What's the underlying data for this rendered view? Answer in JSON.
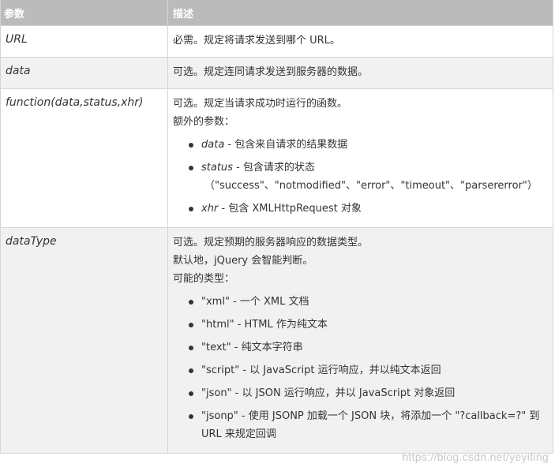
{
  "header": {
    "col_param": "参数",
    "col_desc": "描述"
  },
  "rows": {
    "url": {
      "param": "URL",
      "desc": "必需。规定将请求发送到哪个 URL。"
    },
    "data": {
      "param": "data",
      "desc": "可选。规定连同请求发送到服务器的数据。"
    },
    "function": {
      "param": "function(data,status,xhr)",
      "desc_line1": "可选。规定当请求成功时运行的函数。",
      "desc_line2": "额外的参数：",
      "items": [
        {
          "name": "data",
          "text": " - 包含来自请求的结果数据"
        },
        {
          "name": "status",
          "text": " - 包含请求的状态",
          "sub": "（\"success\"、\"notmodified\"、\"error\"、\"timeout\"、\"parsererror\"）"
        },
        {
          "name": "xhr",
          "text": " - 包含 XMLHttpRequest 对象"
        }
      ]
    },
    "datatype": {
      "param": "dataType",
      "desc_line1": "可选。规定预期的服务器响应的数据类型。",
      "desc_line2": "默认地，jQuery 会智能判断。",
      "desc_line3": "可能的类型：",
      "items": [
        "\"xml\" - 一个 XML 文档",
        "\"html\" - HTML 作为纯文本",
        "\"text\" - 纯文本字符串",
        "\"script\" - 以 JavaScript 运行响应，并以纯文本返回",
        "\"json\" - 以 JSON 运行响应，并以 JavaScript 对象返回",
        "\"jsonp\" - 使用 JSONP 加载一个 JSON 块，将添加一个 \"?callback=?\" 到 URL 来规定回调"
      ]
    }
  },
  "watermark": "https://blog.csdn.net/yeyiting"
}
